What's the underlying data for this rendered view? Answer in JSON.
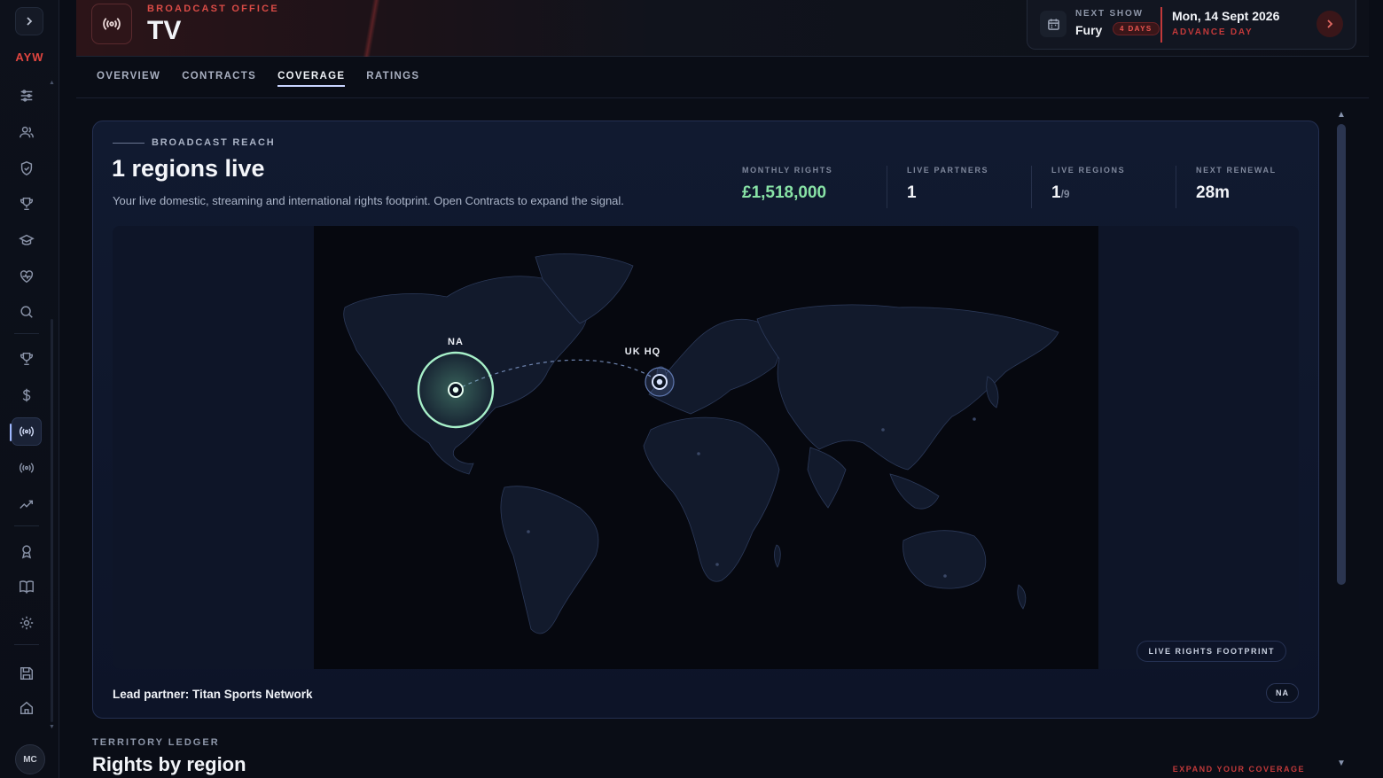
{
  "sidebar": {
    "brand": "AYW",
    "avatar": "MC",
    "items": [
      {
        "icon": "sliders-icon"
      },
      {
        "icon": "users-icon"
      },
      {
        "icon": "shield-icon"
      },
      {
        "icon": "trophy-icon"
      },
      {
        "icon": "graduation-icon"
      },
      {
        "icon": "heart-pulse-icon"
      },
      {
        "icon": "search-icon"
      },
      {
        "icon": "trophy-alt-icon"
      },
      {
        "icon": "dollar-icon"
      },
      {
        "icon": "broadcast-icon",
        "active": true
      },
      {
        "icon": "broadcast-alt-icon"
      },
      {
        "icon": "trend-icon"
      },
      {
        "icon": "award-icon"
      },
      {
        "icon": "book-icon"
      },
      {
        "icon": "gear-icon"
      },
      {
        "icon": "save-icon"
      },
      {
        "icon": "home-icon"
      }
    ]
  },
  "header": {
    "eyebrow": "BROADCAST OFFICE",
    "title": "TV",
    "next_show_label": "NEXT SHOW",
    "next_show_name": "Fury",
    "next_show_badge": "4 DAYS",
    "date": "Mon, 14 Sept 2026",
    "day_type": "ADVANCE DAY"
  },
  "tabs": [
    {
      "label": "OVERVIEW"
    },
    {
      "label": "CONTRACTS"
    },
    {
      "label": "COVERAGE",
      "active": true
    },
    {
      "label": "RATINGS"
    }
  ],
  "reach": {
    "eyebrow": "BROADCAST REACH",
    "title": "1 regions live",
    "subtitle": "Your live domestic, streaming and international rights footprint. Open Contracts to expand the signal.",
    "stats": {
      "monthly_rights_label": "MONTHLY RIGHTS",
      "monthly_rights_value": "£1,518,000",
      "live_partners_label": "LIVE PARTNERS",
      "live_partners_value": "1",
      "live_regions_label": "LIVE REGIONS",
      "live_regions_value": "1",
      "live_regions_total": "/9",
      "next_renewal_label": "NEXT RENEWAL",
      "next_renewal_value": "28m"
    },
    "map": {
      "markers": [
        {
          "label": "NA",
          "status": "live"
        },
        {
          "label": "UK HQ",
          "status": "hq"
        }
      ],
      "footprint_chip": "LIVE RIGHTS FOOTPRINT"
    },
    "lead_partner": "Lead partner: Titan Sports Network",
    "region_chip": "NA"
  },
  "ledger": {
    "eyebrow": "TERRITORY LEDGER",
    "title": "Rights by region",
    "expand_link": "EXPAND YOUR COVERAGE"
  },
  "colors": {
    "accent_red": "#d94b46",
    "live_green": "#88e3a6",
    "panel_bg": "#111a30"
  }
}
